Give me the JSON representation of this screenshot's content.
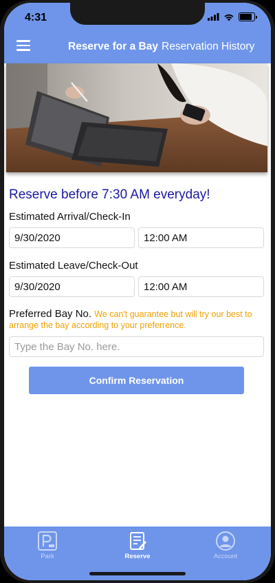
{
  "status_bar": {
    "time": "4:31"
  },
  "nav": {
    "title": "Reserve for a Bay",
    "history_link": "Reservation History"
  },
  "main": {
    "headline": "Reserve before 7:30 AM everyday!",
    "arrival": {
      "label": "Estimated Arrival/Check-In",
      "date": "9/30/2020",
      "time": "12:00 AM"
    },
    "leave": {
      "label": "Estimated Leave/Check-Out",
      "date": "9/30/2020",
      "time": "12:00 AM"
    },
    "bay": {
      "label": "Preferred Bay No.",
      "note": "We can't guarantee but will try our best to arrange the bay according to your preferrence.",
      "placeholder": "Type the Bay No. here."
    },
    "confirm_label": "Confirm Reservation"
  },
  "tabs": [
    {
      "label": "Park",
      "icon": "parking-icon",
      "active": false
    },
    {
      "label": "Reserve",
      "icon": "reserve-icon",
      "active": true
    },
    {
      "label": "Account",
      "icon": "account-icon",
      "active": false
    }
  ],
  "colors": {
    "accent": "#6f95ea",
    "headline": "#1a1aa0",
    "warning": "#f0a000"
  }
}
